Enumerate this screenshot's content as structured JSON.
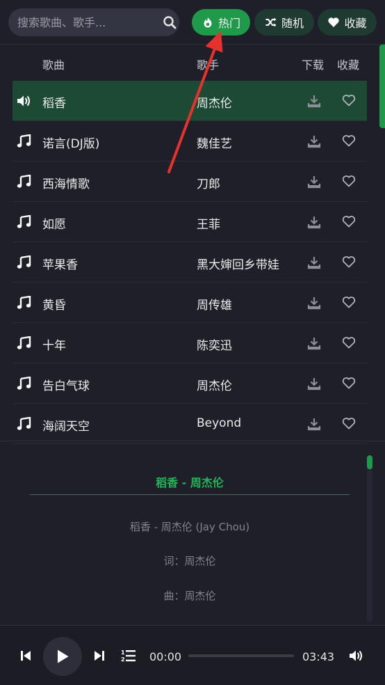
{
  "search": {
    "placeholder": "搜索歌曲、歌手..."
  },
  "tabs": [
    {
      "label": "热门",
      "icon": "flame-icon",
      "active": true
    },
    {
      "label": "随机",
      "icon": "shuffle-icon",
      "active": false
    },
    {
      "label": "收藏",
      "icon": "heart-icon",
      "active": false
    }
  ],
  "table": {
    "headers": {
      "song": "歌曲",
      "artist": "歌手",
      "download": "下载",
      "favorite": "收藏"
    },
    "rows": [
      {
        "title": "稻香",
        "artist": "周杰伦",
        "playing": true
      },
      {
        "title": "诺言(DJ版)",
        "artist": "魏佳艺",
        "playing": false
      },
      {
        "title": "西海情歌",
        "artist": "刀郎",
        "playing": false
      },
      {
        "title": "如愿",
        "artist": "王菲",
        "playing": false
      },
      {
        "title": "苹果香",
        "artist": "黑大婶回乡带娃",
        "playing": false
      },
      {
        "title": "黄昏",
        "artist": "周传雄",
        "playing": false
      },
      {
        "title": "十年",
        "artist": "陈奕迅",
        "playing": false
      },
      {
        "title": "告白气球",
        "artist": "周杰伦",
        "playing": false
      },
      {
        "title": "海阔天空",
        "artist": "Beyond",
        "playing": false
      }
    ]
  },
  "lyrics": {
    "title": "稻香 - 周杰伦",
    "lines": [
      "稻香 - 周杰伦 (Jay Chou)",
      "词：周杰伦",
      "曲：周杰伦"
    ]
  },
  "player": {
    "current_time": "00:00",
    "total_time": "03:43",
    "progress": 0
  },
  "colors": {
    "accent": "#1f9a4a",
    "accent_text": "#22b455",
    "playing_row": "#1d4a34",
    "background": "#1e1f29",
    "annotation": "#e5322d"
  }
}
